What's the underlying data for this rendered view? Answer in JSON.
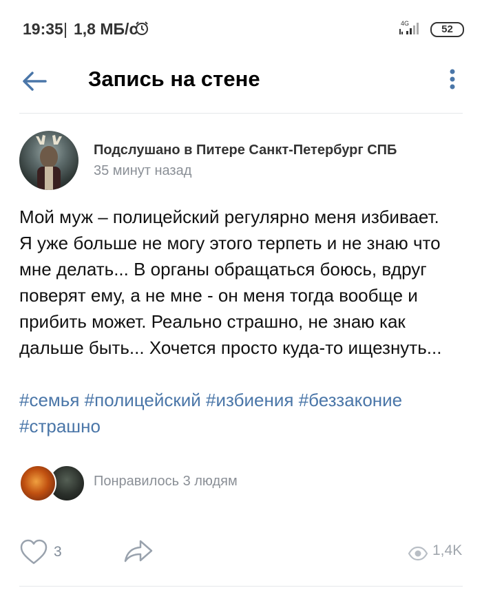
{
  "status_bar": {
    "time": "19:35",
    "separator": "|",
    "speed": "1,8 МБ/с",
    "network": "4G",
    "battery": "52",
    "icons": [
      "alarm-icon",
      "signal-icon",
      "battery-icon"
    ]
  },
  "header": {
    "title": "Запись на стене",
    "icons": [
      "back-arrow-icon",
      "more-vertical-icon"
    ],
    "accent_color": "#4a76a8"
  },
  "post": {
    "author": "Подслушано в Питере Санкт-Петербург СПБ",
    "time_ago": "35 минут назад",
    "text": "Мой муж – полицейский регулярно меня избивает.\nЯ уже больше не могу этого терпеть и не знаю что\nмне делать... В органы обращаться боюсь, вдруг\n поверят ему, а не мне - он меня тогда вообще и\nприбить может. Реально страшно, не знаю как\nдальше быть... Хочется просто куда-то ищезнуть...",
    "hashtags": [
      "#семья",
      "#полицейский",
      "#избиения",
      "#беззаконие",
      "#страшно"
    ],
    "hashtag_color": "#4a76a8"
  },
  "likes": {
    "text": "Понравилось 3 людям",
    "count": "3"
  },
  "views": {
    "count": "1,4K"
  }
}
